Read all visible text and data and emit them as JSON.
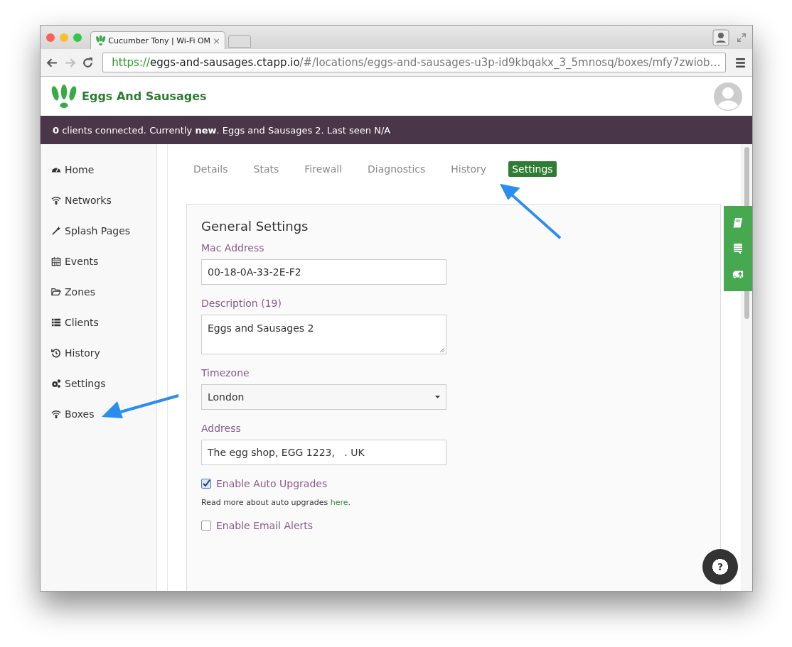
{
  "browser": {
    "tab_title": "Cucumber Tony | Wi-Fi OM",
    "tab_close": "×",
    "url_scheme": "https://",
    "url_host": "eggs-and-sausages.ctapp.io",
    "url_path": "/#/locations/eggs-and-sausages-u3p-id9kbqakx_3_5mnosq/boxes/mfy7zwiob…"
  },
  "header": {
    "brand": "Eggs And Sausages"
  },
  "status_bar": {
    "message": "**0** clients connected. Currently **new**. Eggs and Sausages 2. Last seen N/A"
  },
  "sidebar": {
    "items": [
      {
        "label": "Home"
      },
      {
        "label": "Networks"
      },
      {
        "label": "Splash Pages"
      },
      {
        "label": "Events"
      },
      {
        "label": "Zones"
      },
      {
        "label": "Clients"
      },
      {
        "label": "History"
      },
      {
        "label": "Settings"
      },
      {
        "label": "Boxes"
      }
    ]
  },
  "tabs": [
    {
      "label": "Details",
      "selected": false
    },
    {
      "label": "Stats",
      "selected": false
    },
    {
      "label": "Firewall",
      "selected": false
    },
    {
      "label": "Diagnostics",
      "selected": false
    },
    {
      "label": "History",
      "selected": false
    },
    {
      "label": "Settings",
      "selected": true
    }
  ],
  "form": {
    "title": "General Settings",
    "fields": [
      {
        "kind": "input",
        "label": "Mac Address",
        "value": "00-18-0A-33-2E-F2"
      },
      {
        "kind": "textarea",
        "label": "Description (19)",
        "value": "Eggs and Sausages 2"
      },
      {
        "kind": "select",
        "label": "Timezone",
        "value": "London"
      },
      {
        "kind": "input",
        "label": "Address",
        "value": "The egg shop, EGG 1223,   . UK"
      }
    ],
    "checkboxes": [
      {
        "label": "Enable Auto Upgrades",
        "checked": true,
        "help_before": "Read more about auto upgrades ",
        "help_link": "here",
        "help_after": "."
      },
      {
        "label": "Enable Email Alerts",
        "checked": false
      }
    ]
  },
  "help_button": {
    "label": "?"
  }
}
